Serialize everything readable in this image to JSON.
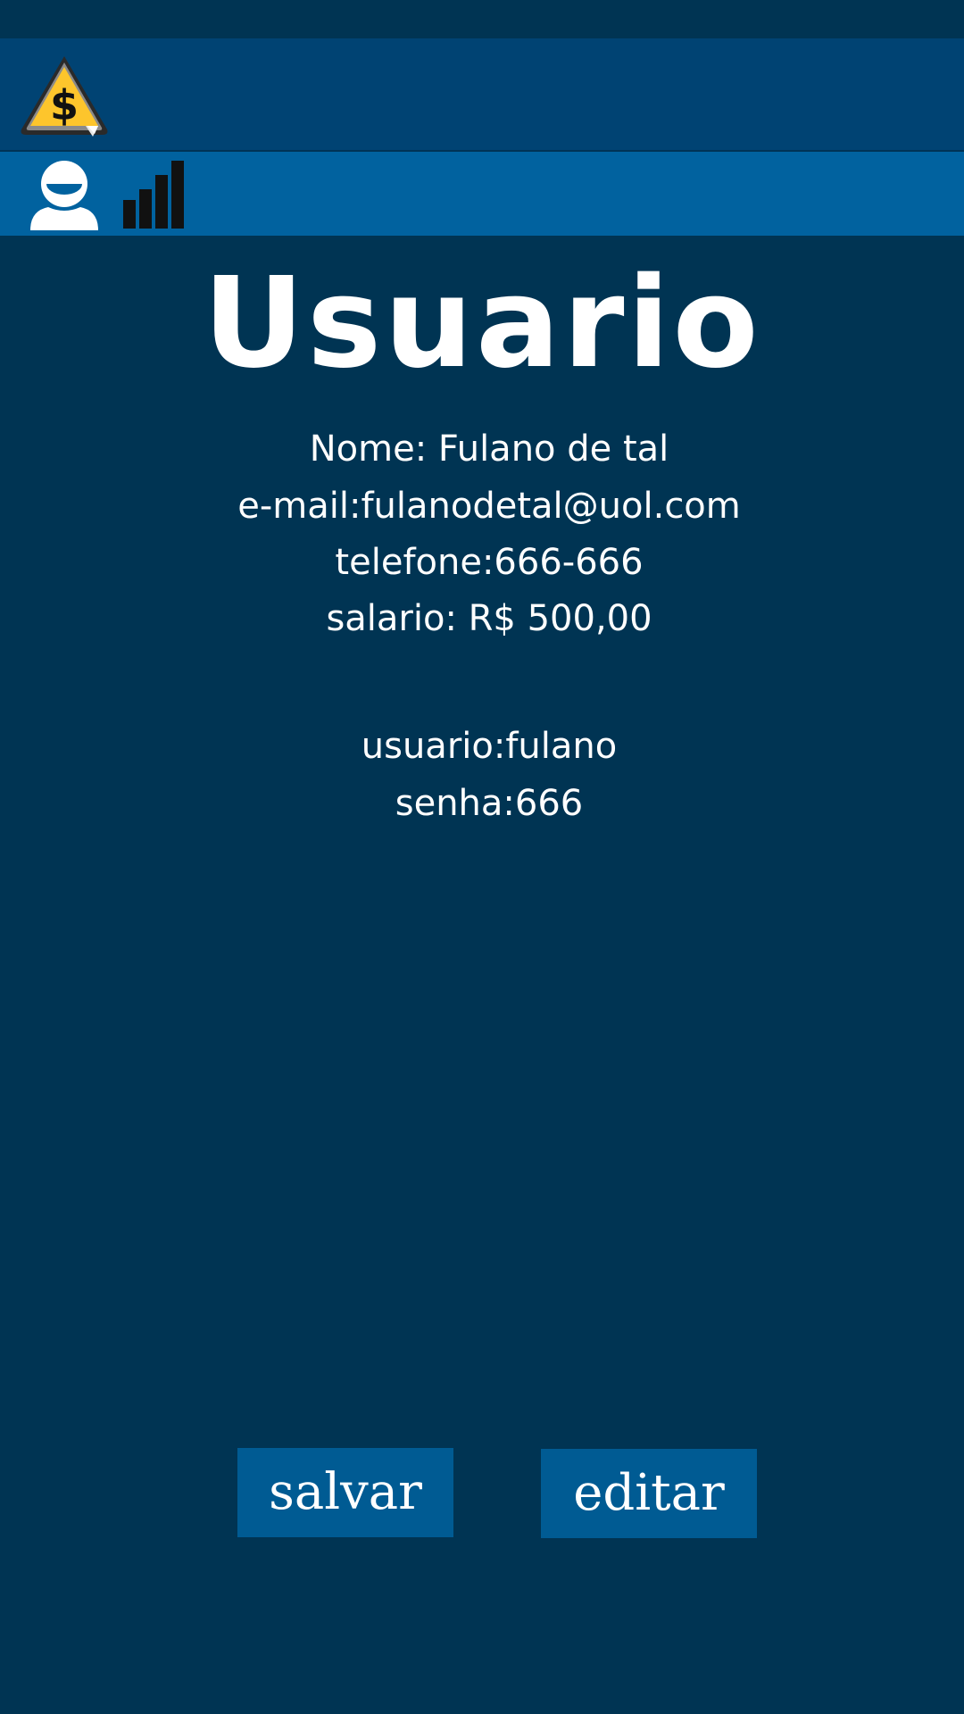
{
  "header": {
    "logo_icon": "warning-dollar-sign-icon"
  },
  "nav": {
    "items": [
      {
        "icon": "user-icon"
      },
      {
        "icon": "bar-chart-icon"
      }
    ]
  },
  "page": {
    "title": "Usuario"
  },
  "profile": {
    "nome": "Nome: Fulano de tal",
    "email": "e-mail:fulanodetal@uol.com",
    "telefone": "telefone:666-666",
    "salario": "salario: R$ 500,00",
    "usuario": "usuario:fulano",
    "senha": "senha:666"
  },
  "actions": {
    "save_label": "salvar",
    "edit_label": "editar"
  },
  "colors": {
    "background": "#003453",
    "header": "#004373",
    "nav_bar": "#01629f",
    "button": "#005b93",
    "logo_yellow": "#fdc52c"
  }
}
